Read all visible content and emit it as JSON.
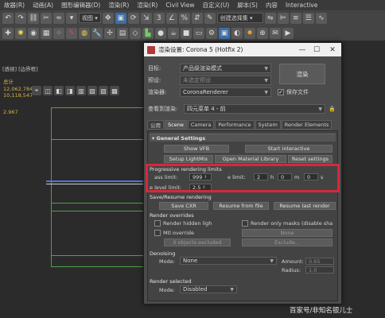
{
  "menubar": {
    "items": [
      "故器(R)",
      "动画(A)",
      "图形编辑器(D)",
      "渲染(R)",
      "渲染(R)",
      "Civil View",
      "自定义(U)",
      "脚本(S)",
      "内容",
      "Interactive"
    ]
  },
  "toolbar1": {
    "view_select": "视图",
    "selection_set": "创建选择集"
  },
  "viewport": {
    "label": "[透视] [边界框]",
    "stats": [
      "总计",
      "12,062,784",
      "10,118,547"
    ],
    "small_stat": "2.967"
  },
  "dialog": {
    "title": "渲染设置: Corona 5 (Hotfix 2)",
    "target_label": "目标:",
    "target_value": "产品级渲染模式",
    "preset_label": "预设:",
    "preset_value": "未选定预设",
    "renderer_label": "渲染器:",
    "renderer_value": "CoronaRenderer",
    "save_file_label": "保存文件",
    "view_label": "查看到渲染:",
    "view_value": "四元菜单 4 - 前",
    "render_button": "渲染",
    "tabs": [
      "公用",
      "Scene",
      "Camera",
      "Performance",
      "System",
      "Render Elements"
    ],
    "active_tab": "Scene",
    "general_settings": "General Settings",
    "show_vfb": "Show VFB",
    "start_interactive": "Start interactive",
    "setup_lightmix": "Setup LightMix",
    "open_material_library": "Open Material Library",
    "reset_settings": "Reset settings",
    "progressive_title": "Progressive rendering limits",
    "pass_limit_label": "ass limit:",
    "pass_limit_value": "999",
    "time_limit_label": "e limit:",
    "time_h": "2",
    "time_h_unit": "h",
    "time_m": "0",
    "time_m_unit": "m",
    "time_s": "0",
    "time_s_unit": "s",
    "noise_label": "e level limit:",
    "noise_value": "2.5",
    "save_resume_title": "Save/Resume rendering",
    "save_cxr": "Save CXR",
    "resume_from_file": "Resume from file",
    "resume_last_render": "Resume last render",
    "render_overrides": "Render overrides",
    "render_hidden": "Render hidden ligh",
    "render_only_masks": "Render only masks (disable sha",
    "mtl_override": "Mtl override",
    "mtl_override_value": "None",
    "objects_excluded": "0 objects excluded",
    "exclude": "Exclude...",
    "denoising": "Denoising",
    "mode_label": "Mode:",
    "denoise_mode": "None",
    "amount_label": "Amount:",
    "amount_value": "0.65",
    "radius_label": "Radius:",
    "radius_value": "1.0",
    "render_selected": "Render selected",
    "render_selected_mode": "Disabled"
  },
  "watermark": "百家号/非知名银儿士",
  "colors": {
    "highlight": "#d8283a",
    "stats_text": "#d6b24a"
  }
}
